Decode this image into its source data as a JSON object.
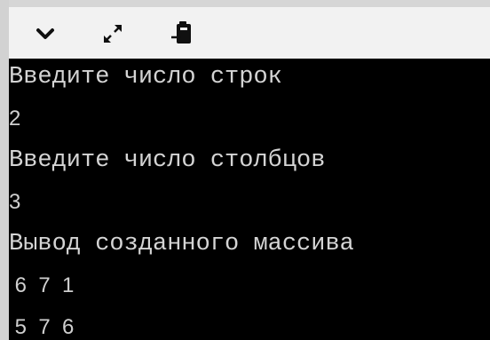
{
  "toolbar": {
    "icons": [
      "chevron-down-icon",
      "expand-icon",
      "clipboard-paste-icon"
    ],
    "icon_color": "#101010"
  },
  "console": {
    "background": "#000000",
    "foreground": "#d4d4d4",
    "lines": [
      "Введите число строк",
      "2",
      "Введите число столбцов",
      "3",
      "Вывод созданного массива",
      " 6  7  1",
      " 5  7  6"
    ]
  }
}
